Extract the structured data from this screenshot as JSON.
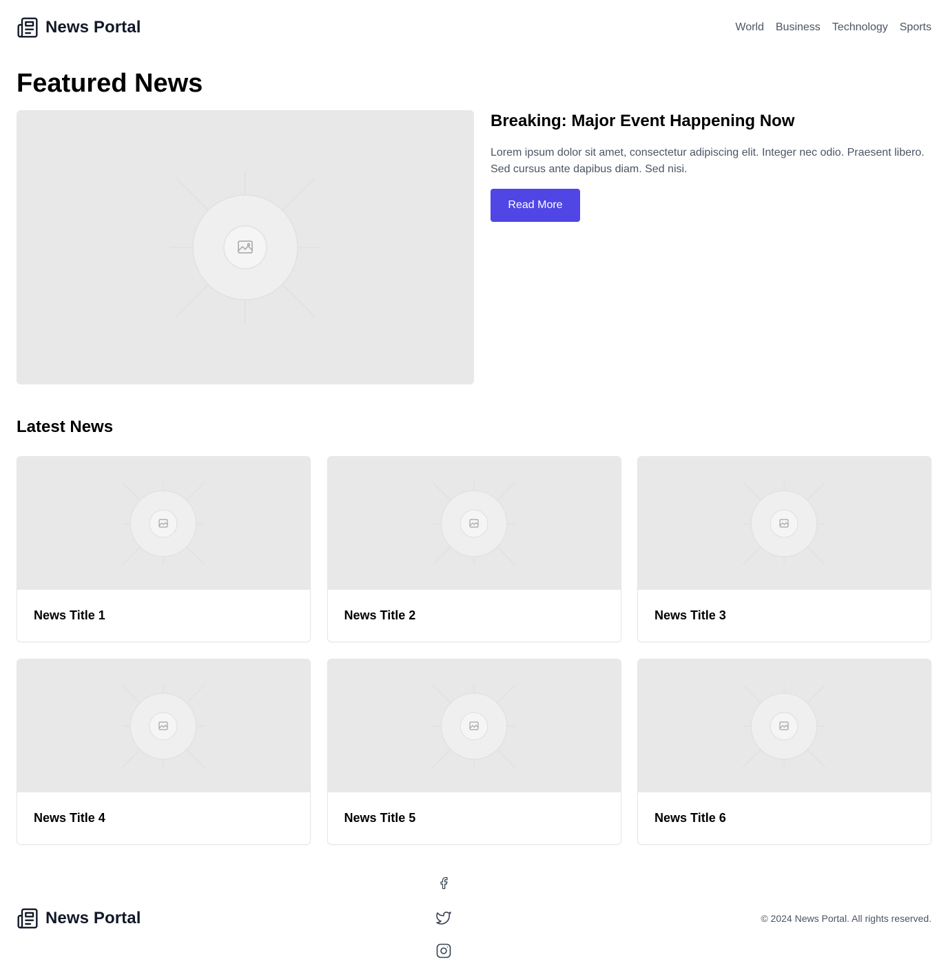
{
  "header": {
    "brand": "News Portal",
    "brand_icon": "newspaper-icon",
    "nav": [
      "World",
      "Business",
      "Technology",
      "Sports"
    ]
  },
  "featured": {
    "section_title": "Featured News",
    "headline": "Breaking: Major Event Happening Now",
    "description": "Lorem ipsum dolor sit amet, consectetur adipiscing elit. Integer nec odio. Praesent libero. Sed cursus ante dapibus diam. Sed nisi.",
    "button_label": "Read More",
    "image_icon": "image-placeholder-icon"
  },
  "latest": {
    "section_title": "Latest News",
    "items": [
      {
        "title": "News Title 1"
      },
      {
        "title": "News Title 2"
      },
      {
        "title": "News Title 3"
      },
      {
        "title": "News Title 4"
      },
      {
        "title": "News Title 5"
      },
      {
        "title": "News Title 6"
      }
    ]
  },
  "footer": {
    "brand": "News Portal",
    "socials": [
      "facebook-icon",
      "twitter-icon",
      "instagram-icon"
    ],
    "copyright": "© 2024 News Portal. All rights reserved."
  },
  "colors": {
    "accent": "#4f46e5",
    "placeholder_bg": "#e8e8e8",
    "muted_text": "#4b5563"
  }
}
